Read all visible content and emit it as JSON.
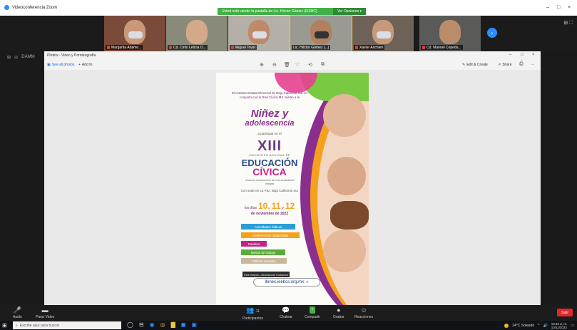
{
  "window": {
    "app_title": "Videoconferencia Zoom",
    "share_banner": "Usted está viendo la pantalla de Lic. Héctor Gómez (IEEBC)",
    "view_options": "Ver Opciones ▾",
    "controls": [
      "–",
      "□",
      "×"
    ]
  },
  "participants": [
    {
      "name": "Margarita Adame..."
    },
    {
      "name": "Cd. Cirilo Leticia O..."
    },
    {
      "name": "Miguel Tovar"
    },
    {
      "name": "Lic. Héctor Gómez (...)"
    },
    {
      "name": "Xavier Anchleh"
    },
    {
      "name": "Cd. Manoel Cepeda..."
    }
  ],
  "strip_icons": [
    "⊞",
    "⛶"
  ],
  "left_icons": [
    "⊞",
    "◎",
    "DAMM"
  ],
  "photos": {
    "title": "Photos - Video y Pornteografía",
    "title_controls": [
      "–",
      "□",
      "×"
    ],
    "toolbar": {
      "see_all": "See all photos",
      "add_to": "Add to",
      "edit_create": "Edit & Create",
      "share": "Share",
      "print_icon": "print-icon",
      "more": "···"
    },
    "center_icons": [
      "⊕",
      "⊖",
      "🗑",
      "♡",
      "⟲",
      "⧉"
    ]
  },
  "poster": {
    "intro": "El Instituto Estatal Electoral de Baja California Sur en conjunto con la Red Cívica MX invitan a la",
    "headline1": "Niñez y",
    "headline2": "adolescencia",
    "participate": "a participar en el",
    "edition": "XIII",
    "encuentro": "ENCUENTRO NACIONAL DE",
    "title1": "EDUCACIÓN",
    "title2": "CÍVICA",
    "tagline": "Hacia la construcción de una ciudadanía integral",
    "sede": "Con sede en La Paz, Baja California Sur",
    "days_prefix": "los días",
    "day1": "10,",
    "day2": "11",
    "day_y": "y",
    "day3": "12",
    "month": "de noviembre de 2022",
    "activities": [
      {
        "label": "Actividades lúdicas",
        "color": "#2a9fd6"
      },
      {
        "label": "Conferencias magistrales",
        "color": "#f5a11c"
      },
      {
        "label": "Paneles",
        "color": "#c2248c"
      },
      {
        "label": "Mesas de trabajo",
        "color": "#5aac3a"
      },
      {
        "label": "Talleres virtuales",
        "color": "#c9b79a"
      }
    ],
    "url": "llenec.ieebcs.org.mx",
    "tooltip": "Este mapeo, distorsionar invitación"
  },
  "controlbar": {
    "audio": "Audio",
    "video": "Parar Video",
    "participants": "Participantes",
    "participants_count": "11",
    "chat": "Chatear",
    "share": "Compartir",
    "record": "Grabar",
    "reactions": "Reacciones",
    "leave": "Salir"
  },
  "taskbar": {
    "search_placeholder": "Escribe aquí para buscar",
    "weather": "24°C Soleado",
    "time": "10:45 a. m.",
    "date": "10/11/2022"
  },
  "colors": {
    "share_green": "#43b047",
    "zoom_blue": "#2d8cff",
    "leave_red": "#e02828"
  }
}
